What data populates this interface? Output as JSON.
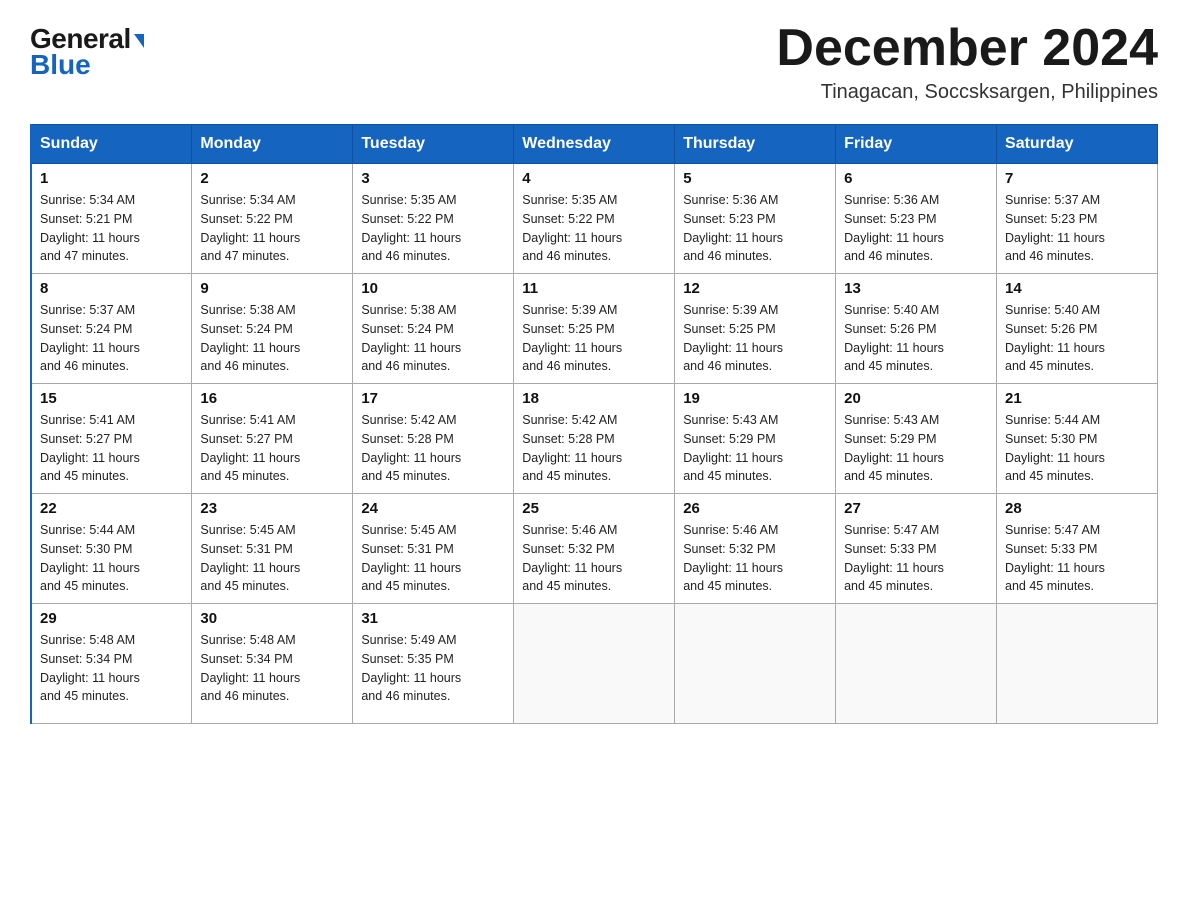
{
  "logo": {
    "general": "General",
    "blue": "Blue"
  },
  "header": {
    "month": "December 2024",
    "location": "Tinagacan, Soccsksargen, Philippines"
  },
  "days_of_week": [
    "Sunday",
    "Monday",
    "Tuesday",
    "Wednesday",
    "Thursday",
    "Friday",
    "Saturday"
  ],
  "weeks": [
    [
      {
        "num": "1",
        "sunrise": "5:34 AM",
        "sunset": "5:21 PM",
        "daylight": "11 hours and 47 minutes."
      },
      {
        "num": "2",
        "sunrise": "5:34 AM",
        "sunset": "5:22 PM",
        "daylight": "11 hours and 47 minutes."
      },
      {
        "num": "3",
        "sunrise": "5:35 AM",
        "sunset": "5:22 PM",
        "daylight": "11 hours and 46 minutes."
      },
      {
        "num": "4",
        "sunrise": "5:35 AM",
        "sunset": "5:22 PM",
        "daylight": "11 hours and 46 minutes."
      },
      {
        "num": "5",
        "sunrise": "5:36 AM",
        "sunset": "5:23 PM",
        "daylight": "11 hours and 46 minutes."
      },
      {
        "num": "6",
        "sunrise": "5:36 AM",
        "sunset": "5:23 PM",
        "daylight": "11 hours and 46 minutes."
      },
      {
        "num": "7",
        "sunrise": "5:37 AM",
        "sunset": "5:23 PM",
        "daylight": "11 hours and 46 minutes."
      }
    ],
    [
      {
        "num": "8",
        "sunrise": "5:37 AM",
        "sunset": "5:24 PM",
        "daylight": "11 hours and 46 minutes."
      },
      {
        "num": "9",
        "sunrise": "5:38 AM",
        "sunset": "5:24 PM",
        "daylight": "11 hours and 46 minutes."
      },
      {
        "num": "10",
        "sunrise": "5:38 AM",
        "sunset": "5:24 PM",
        "daylight": "11 hours and 46 minutes."
      },
      {
        "num": "11",
        "sunrise": "5:39 AM",
        "sunset": "5:25 PM",
        "daylight": "11 hours and 46 minutes."
      },
      {
        "num": "12",
        "sunrise": "5:39 AM",
        "sunset": "5:25 PM",
        "daylight": "11 hours and 46 minutes."
      },
      {
        "num": "13",
        "sunrise": "5:40 AM",
        "sunset": "5:26 PM",
        "daylight": "11 hours and 45 minutes."
      },
      {
        "num": "14",
        "sunrise": "5:40 AM",
        "sunset": "5:26 PM",
        "daylight": "11 hours and 45 minutes."
      }
    ],
    [
      {
        "num": "15",
        "sunrise": "5:41 AM",
        "sunset": "5:27 PM",
        "daylight": "11 hours and 45 minutes."
      },
      {
        "num": "16",
        "sunrise": "5:41 AM",
        "sunset": "5:27 PM",
        "daylight": "11 hours and 45 minutes."
      },
      {
        "num": "17",
        "sunrise": "5:42 AM",
        "sunset": "5:28 PM",
        "daylight": "11 hours and 45 minutes."
      },
      {
        "num": "18",
        "sunrise": "5:42 AM",
        "sunset": "5:28 PM",
        "daylight": "11 hours and 45 minutes."
      },
      {
        "num": "19",
        "sunrise": "5:43 AM",
        "sunset": "5:29 PM",
        "daylight": "11 hours and 45 minutes."
      },
      {
        "num": "20",
        "sunrise": "5:43 AM",
        "sunset": "5:29 PM",
        "daylight": "11 hours and 45 minutes."
      },
      {
        "num": "21",
        "sunrise": "5:44 AM",
        "sunset": "5:30 PM",
        "daylight": "11 hours and 45 minutes."
      }
    ],
    [
      {
        "num": "22",
        "sunrise": "5:44 AM",
        "sunset": "5:30 PM",
        "daylight": "11 hours and 45 minutes."
      },
      {
        "num": "23",
        "sunrise": "5:45 AM",
        "sunset": "5:31 PM",
        "daylight": "11 hours and 45 minutes."
      },
      {
        "num": "24",
        "sunrise": "5:45 AM",
        "sunset": "5:31 PM",
        "daylight": "11 hours and 45 minutes."
      },
      {
        "num": "25",
        "sunrise": "5:46 AM",
        "sunset": "5:32 PM",
        "daylight": "11 hours and 45 minutes."
      },
      {
        "num": "26",
        "sunrise": "5:46 AM",
        "sunset": "5:32 PM",
        "daylight": "11 hours and 45 minutes."
      },
      {
        "num": "27",
        "sunrise": "5:47 AM",
        "sunset": "5:33 PM",
        "daylight": "11 hours and 45 minutes."
      },
      {
        "num": "28",
        "sunrise": "5:47 AM",
        "sunset": "5:33 PM",
        "daylight": "11 hours and 45 minutes."
      }
    ],
    [
      {
        "num": "29",
        "sunrise": "5:48 AM",
        "sunset": "5:34 PM",
        "daylight": "11 hours and 45 minutes."
      },
      {
        "num": "30",
        "sunrise": "5:48 AM",
        "sunset": "5:34 PM",
        "daylight": "11 hours and 46 minutes."
      },
      {
        "num": "31",
        "sunrise": "5:49 AM",
        "sunset": "5:35 PM",
        "daylight": "11 hours and 46 minutes."
      },
      null,
      null,
      null,
      null
    ]
  ],
  "labels": {
    "sunrise": "Sunrise:",
    "sunset": "Sunset:",
    "daylight": "Daylight:"
  }
}
